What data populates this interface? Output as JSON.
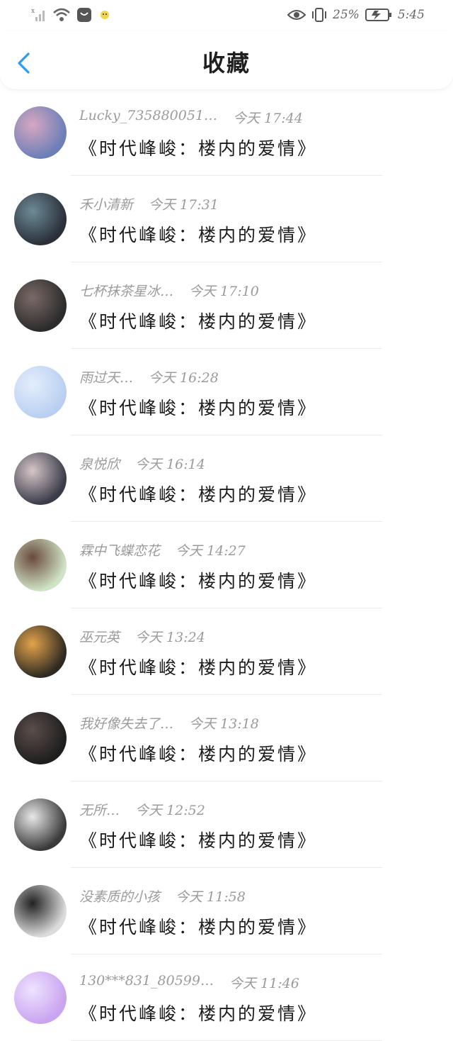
{
  "status_bar": {
    "battery": "25%",
    "time": "5:45"
  },
  "header": {
    "title": "收藏"
  },
  "favorites": [
    {
      "name": "Lucky_735880051…",
      "time": "今天 17:44",
      "content": "《时代峰峻：楼内的爱情》",
      "avatar_colors": [
        "#6c7fb8",
        "#d7a7c0"
      ]
    },
    {
      "name": "禾小清新",
      "time": "今天 17:31",
      "content": "《时代峰峻：楼内的爱情》",
      "avatar_colors": [
        "#2a2f38",
        "#6d8a97"
      ]
    },
    {
      "name": "七杯抹茶星冰…",
      "time": "今天 17:10",
      "content": "《时代峰峻：楼内的爱情》",
      "avatar_colors": [
        "#2b2b2b",
        "#7a6a66"
      ]
    },
    {
      "name": "雨过天…",
      "time": "今天 16:28",
      "content": "《时代峰峻：楼内的爱情》",
      "avatar_colors": [
        "#b9cff2",
        "#e4eefc"
      ]
    },
    {
      "name": "泉悦欣",
      "time": "今天 16:14",
      "content": "《时代峰峻：楼内的爱情》",
      "avatar_colors": [
        "#3b3c4a",
        "#d6c6c8"
      ]
    },
    {
      "name": "霖中飞蝶恋花",
      "time": "今天 14:27",
      "content": "《时代峰峻：楼内的爱情》",
      "avatar_colors": [
        "#cfe3c5",
        "#6a4a3b"
      ]
    },
    {
      "name": "巫元英",
      "time": "今天 13:24",
      "content": "《时代峰峻：楼内的爱情》",
      "avatar_colors": [
        "#2e2a22",
        "#e3a34a"
      ]
    },
    {
      "name": "我好像失去了…",
      "time": "今天 13:18",
      "content": "《时代峰峻：楼内的爱情》",
      "avatar_colors": [
        "#1e1e1e",
        "#5b4d49"
      ]
    },
    {
      "name": "无所…",
      "time": "今天 12:52",
      "content": "《时代峰峻：楼内的爱情》",
      "avatar_colors": [
        "#3a3a3a",
        "#e8e8e8"
      ]
    },
    {
      "name": "没素质的小孩",
      "time": "今天 11:58",
      "content": "《时代峰峻：楼内的爱情》",
      "avatar_colors": [
        "#dcdcdc",
        "#222222"
      ]
    },
    {
      "name": "130***831_80599…",
      "time": "今天 11:46",
      "content": "《时代峰峻：楼内的爱情》",
      "avatar_colors": [
        "#c9a4f0",
        "#efe2ff"
      ]
    }
  ],
  "icons": {
    "back": "chevron-left-icon",
    "accent": "#2b9bf4"
  }
}
